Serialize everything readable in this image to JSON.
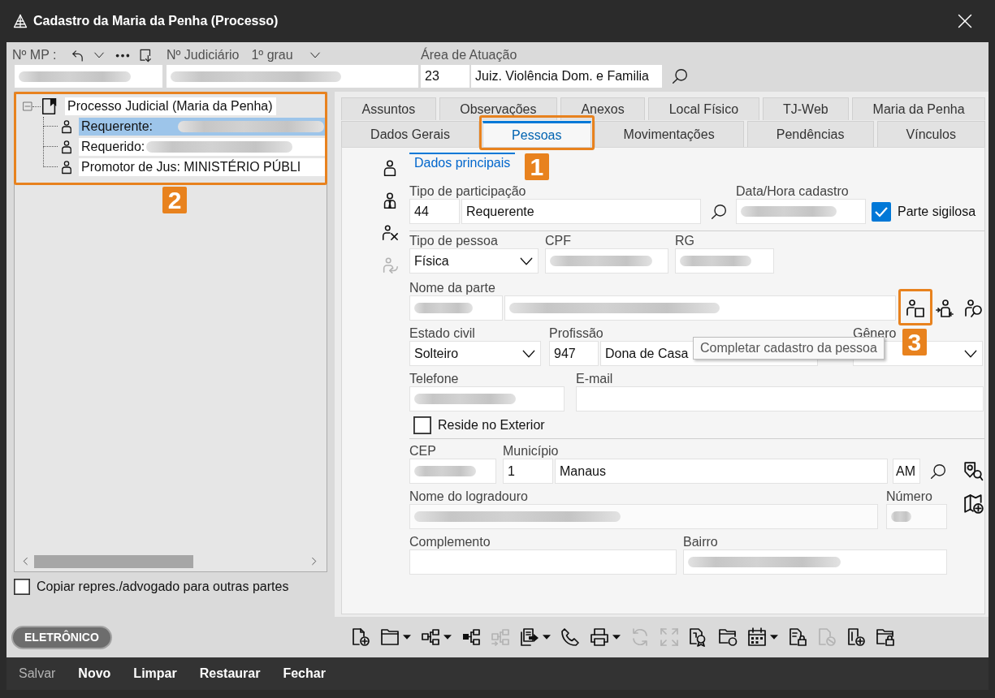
{
  "window": {
    "title": "Cadastro da Maria da Penha (Processo)"
  },
  "header": {
    "mp": {
      "label": "Nº MP :",
      "blurred": true
    },
    "judiciario": {
      "label": "Nº Judiciário",
      "grau": "1º grau",
      "blurred": true
    },
    "area": {
      "label": "Área de Atuação",
      "code": "23",
      "name": "Juiz. Violência Dom. e Familia"
    }
  },
  "tree": {
    "annotation": "2",
    "root": {
      "label": "Processo Judicial (Maria da Penha)",
      "expanded": true,
      "children": [
        {
          "label": "Requerente:",
          "selected": true,
          "blurred": true
        },
        {
          "label": "Requerido:",
          "selected": false,
          "blurred": true
        },
        {
          "label": "Promotor de Jus: MINISTÉRIO PÚBLI",
          "selected": false,
          "blurred": false
        }
      ]
    }
  },
  "copy_option": {
    "label": "Copiar repres./advogado para outras partes",
    "checked": false
  },
  "mode_badge": "ELETRÔNICO",
  "tab_rows": [
    [
      {
        "label": "Assuntos",
        "selected": false
      },
      {
        "label": "Observações",
        "selected": false
      },
      {
        "label": "Anexos",
        "selected": false
      },
      {
        "label": "Local Físico",
        "selected": false
      },
      {
        "label": "TJ-Web",
        "selected": false
      },
      {
        "label": "Maria da Penha",
        "selected": false
      }
    ],
    [
      {
        "label": "Dados Gerais",
        "selected": false
      },
      {
        "label": "Pessoas",
        "selected": true,
        "annotation": "1"
      },
      {
        "label": "Movimentações",
        "selected": false
      },
      {
        "label": "Pendências",
        "selected": false
      },
      {
        "label": "Vínculos",
        "selected": false
      }
    ]
  ],
  "side_tools": [
    {
      "kind": "person",
      "disabled": false
    },
    {
      "kind": "person-tie",
      "disabled": false
    },
    {
      "kind": "person-remove",
      "disabled": false
    },
    {
      "kind": "person-return",
      "disabled": true
    }
  ],
  "subtabs": [
    {
      "label": "Dados principais",
      "selected": true
    }
  ],
  "form": {
    "participacao": {
      "label": "Tipo de participação",
      "code": "44",
      "name": "Requerente"
    },
    "cadastro": {
      "label": "Data/Hora cadastro",
      "blurred": true
    },
    "sigilosa": {
      "label": "Parte sigilosa",
      "checked": true
    },
    "tipo_pessoa": {
      "label": "Tipo de pessoa",
      "value": "Física"
    },
    "cpf": {
      "label": "CPF",
      "blurred": true
    },
    "rg": {
      "label": "RG",
      "blurred": true
    },
    "nome": {
      "label": "Nome da parte",
      "code_blurred": true,
      "name_blurred": true
    },
    "nome_tools": [
      {
        "kind": "person-card",
        "annotation": "3"
      },
      {
        "kind": "person-swap"
      },
      {
        "kind": "person-search"
      }
    ],
    "tooltip": "Completar cadastro da pessoa",
    "estado_civil": {
      "label": "Estado civil",
      "value": "Solteiro"
    },
    "profissao": {
      "label": "Profissão",
      "code": "947",
      "name": "Dona de Casa"
    },
    "genero": {
      "label": "Gênero"
    },
    "telefone": {
      "label": "Telefone",
      "blurred": true
    },
    "email": {
      "label": "E-mail"
    },
    "exterior": {
      "label": "Reside no Exterior",
      "checked": false
    },
    "cep": {
      "label": "CEP",
      "blurred": true
    },
    "municipio": {
      "label": "Município",
      "code": "1",
      "name": "Manaus",
      "uf": "AM"
    },
    "logradouro": {
      "label": "Nome do logradouro",
      "blurred": true
    },
    "numero": {
      "label": "Número",
      "blurred": true
    },
    "complemento": {
      "label": "Complemento"
    },
    "bairro": {
      "label": "Bairro",
      "blurred": true
    }
  },
  "toolbar": [
    {
      "kind": "doc-add",
      "dropdown": false,
      "disabled": false
    },
    {
      "kind": "folder",
      "dropdown": true,
      "disabled": false
    },
    {
      "kind": "hierarchy",
      "dropdown": true,
      "disabled": false
    },
    {
      "kind": "hierarchy-filled",
      "dropdown": false,
      "disabled": false
    },
    {
      "kind": "hierarchy-link",
      "dropdown": false,
      "disabled": true
    },
    {
      "kind": "docs-arrow",
      "dropdown": true,
      "disabled": false
    },
    {
      "kind": "phone",
      "dropdown": false,
      "disabled": false
    },
    {
      "kind": "printer",
      "dropdown": true,
      "disabled": false
    },
    {
      "kind": "refresh",
      "dropdown": false,
      "disabled": true
    },
    {
      "kind": "expand",
      "dropdown": false,
      "disabled": true
    },
    {
      "kind": "doc-seal",
      "dropdown": false,
      "disabled": false
    },
    {
      "kind": "folder-clock",
      "dropdown": false,
      "disabled": false
    },
    {
      "kind": "calendar",
      "dropdown": true,
      "disabled": false
    },
    {
      "kind": "doc-lock",
      "dropdown": false,
      "disabled": false
    },
    {
      "kind": "doc-cancel",
      "dropdown": false,
      "disabled": true
    },
    {
      "kind": "doc-info-add",
      "dropdown": false,
      "disabled": false
    },
    {
      "kind": "folder-lock",
      "dropdown": false,
      "disabled": false
    }
  ],
  "actions": [
    {
      "label": "Salvar",
      "disabled": true
    },
    {
      "label": "Novo",
      "disabled": false
    },
    {
      "label": "Limpar",
      "disabled": false
    },
    {
      "label": "Restaurar",
      "disabled": false
    },
    {
      "label": "Fechar",
      "disabled": false
    }
  ]
}
